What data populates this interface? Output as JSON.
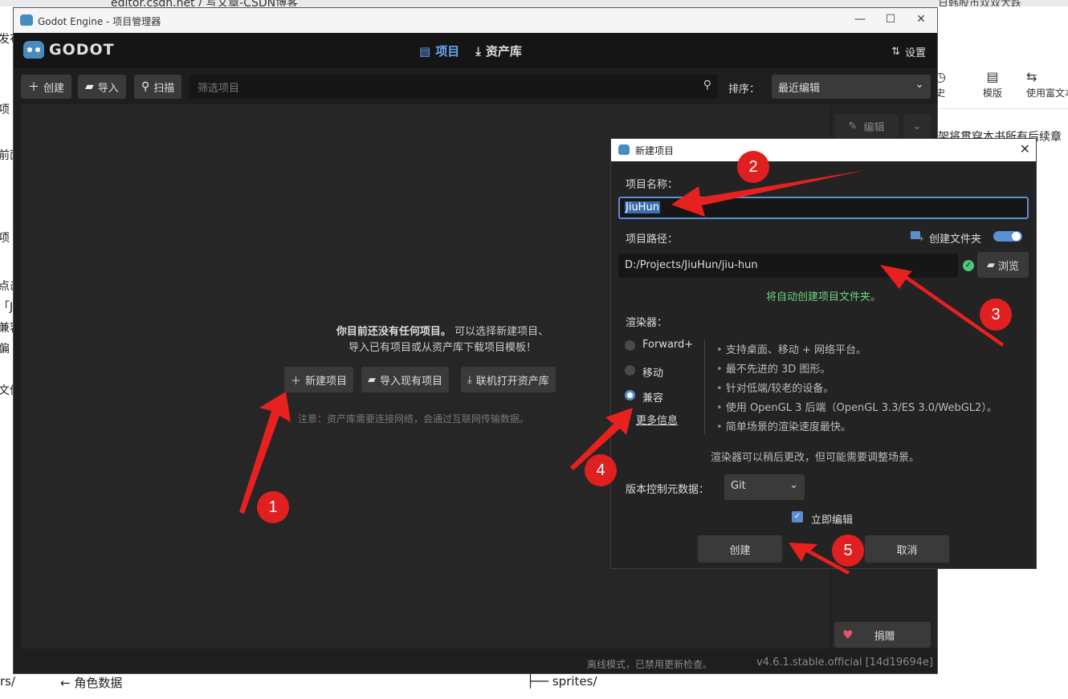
{
  "browser": {
    "url": "editor.csdn.net / 写文章-CSDN博客",
    "right_text": "日韩股市双双大跌",
    "left_fragments": [
      "发布",
      "项",
      "前面",
      "项",
      "点击",
      "「J",
      "兼容",
      "偏",
      "文件"
    ],
    "right_toolbar": [
      {
        "icon": "history-icon",
        "label": "史"
      },
      {
        "icon": "template-icon",
        "label": "模版"
      },
      {
        "icon": "rich-text-icon",
        "label": "使用富文本"
      }
    ],
    "right_text_body": "架将贯穿本书所有后续章",
    "bottom_fragments": [
      "rs/",
      "← 角色数据",
      "├── sprites/"
    ]
  },
  "window": {
    "title": "Godot Engine - 项目管理器",
    "brand": "GODOT",
    "tabs": [
      {
        "label": "项目",
        "icon": "project-list-icon"
      },
      {
        "label": "资产库",
        "icon": "download-icon"
      }
    ],
    "settings_label": "设置"
  },
  "toolbar": {
    "create_label": "创建",
    "import_label": "导入",
    "scan_label": "扫描",
    "filter_placeholder": "筛选项目",
    "sort_label": "排序：",
    "sort_value": "最近编辑"
  },
  "empty_state": {
    "message_bold": "你目前还没有任何项目。",
    "message_rest": "可以选择新建项目、",
    "message_line2": "导入已有项目或从资产库下载项目模板！",
    "new_project": "新建项目",
    "import_existing": "导入现有项目",
    "open_asset_lib": "联机打开资产库",
    "note": "注意：资产库需要连接网络，会通过互联网传输数据。"
  },
  "side_panel": {
    "edit_label": "编辑",
    "donate_label": "捐赠"
  },
  "statusbar": {
    "offline": "离线模式，已禁用更新检查。",
    "version": "v4.6.1.stable.official [14d19694e]"
  },
  "dialog": {
    "title": "新建项目",
    "name_label": "项目名称：",
    "name_value": "JiuHun",
    "path_label": "项目路径：",
    "create_folder_label": "创建文件夹",
    "path_value": "D:/Projects/JiuHun/jiu-hun",
    "browse_label": "浏览",
    "path_hint": "将自动创建项目文件夹。",
    "renderer_label": "渲染器：",
    "renderers": [
      {
        "label": "Forward+",
        "selected": false
      },
      {
        "label": "移动",
        "selected": false
      },
      {
        "label": "兼容",
        "selected": true
      }
    ],
    "more_info": "更多信息",
    "features": [
      "支持桌面、移动 + 网络平台。",
      "最不先进的 3D 图形。",
      "针对低端/较老的设备。",
      "使用 OpenGL 3 后端（OpenGL 3.3/ES 3.0/WebGL2）。",
      "简单场景的渲染速度最快。"
    ],
    "renderer_note": "渲染器可以稍后更改，但可能需要调整场景。",
    "vcs_label": "版本控制元数据：",
    "vcs_value": "Git",
    "edit_now_label": "立即编辑",
    "create_button": "创建",
    "cancel_button": "取消"
  },
  "annotations": [
    "1",
    "2",
    "3",
    "4",
    "5"
  ],
  "colors": {
    "accent": "#5a8fd0",
    "success": "#6ad67e",
    "annotation": "#e02020"
  }
}
